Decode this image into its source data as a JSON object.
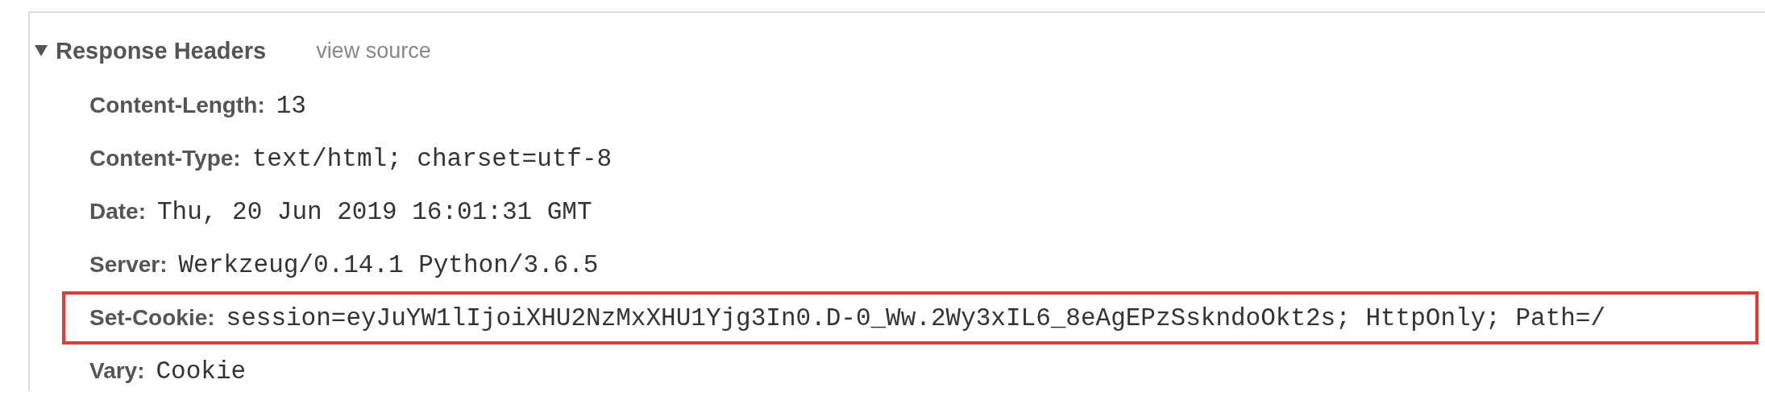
{
  "section": {
    "title": "Response Headers",
    "expanded": true,
    "link": "view source"
  },
  "headers": [
    {
      "name": "Content-Length:",
      "value": "13",
      "highlighted": false
    },
    {
      "name": "Content-Type:",
      "value": "text/html; charset=utf-8",
      "highlighted": false
    },
    {
      "name": "Date:",
      "value": "Thu, 20 Jun 2019 16:01:31 GMT",
      "highlighted": false
    },
    {
      "name": "Server:",
      "value": "Werkzeug/0.14.1 Python/3.6.5",
      "highlighted": false
    },
    {
      "name": "Set-Cookie:",
      "value": "session=eyJuYW1lIjoiXHU2NzMxXHU1Yjg3In0.D-0_Ww.2Wy3xIL6_8eAgEPzSskndoOkt2s; HttpOnly; Path=/",
      "highlighted": true
    },
    {
      "name": "Vary:",
      "value": "Cookie",
      "highlighted": false
    }
  ]
}
